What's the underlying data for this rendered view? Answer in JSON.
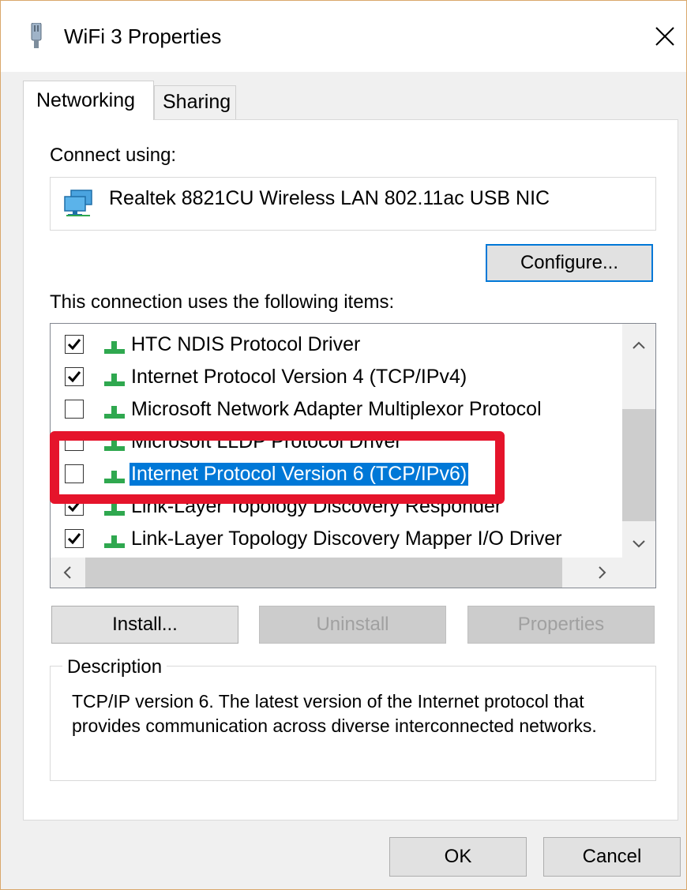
{
  "window": {
    "title": "WiFi 3 Properties",
    "close_label": "✕"
  },
  "tabs": [
    {
      "label": "Networking",
      "active": true
    },
    {
      "label": "Sharing",
      "active": false
    }
  ],
  "connect_using": {
    "label": "Connect using:",
    "adapter_name": "Realtek 8821CU Wireless LAN 802.11ac USB NIC",
    "configure_label": "Configure..."
  },
  "items_section": {
    "label": "This connection uses the following items:",
    "items": [
      {
        "label": "HTC NDIS Protocol Driver",
        "checked": true,
        "selected": false
      },
      {
        "label": "Internet Protocol Version 4 (TCP/IPv4)",
        "checked": true,
        "selected": false
      },
      {
        "label": "Microsoft Network Adapter Multiplexor Protocol",
        "checked": false,
        "selected": false
      },
      {
        "label": "Microsoft LLDP Protocol Driver",
        "checked": false,
        "selected": false
      },
      {
        "label": "Internet Protocol Version 6 (TCP/IPv6)",
        "checked": false,
        "selected": true
      },
      {
        "label": "Link-Layer Topology Discovery Responder",
        "checked": true,
        "selected": false
      },
      {
        "label": "Link-Layer Topology Discovery Mapper I/O Driver",
        "checked": true,
        "selected": false
      }
    ]
  },
  "buttons": {
    "install": "Install...",
    "uninstall": "Uninstall",
    "properties": "Properties",
    "ok": "OK",
    "cancel": "Cancel"
  },
  "description": {
    "legend": "Description",
    "text": "TCP/IP version 6. The latest version of the Internet protocol that provides communication across diverse interconnected networks."
  },
  "colors": {
    "selection": "#0078d7",
    "highlight_annotation": "#e5142b",
    "protocol_icon": "#2fa84f"
  }
}
